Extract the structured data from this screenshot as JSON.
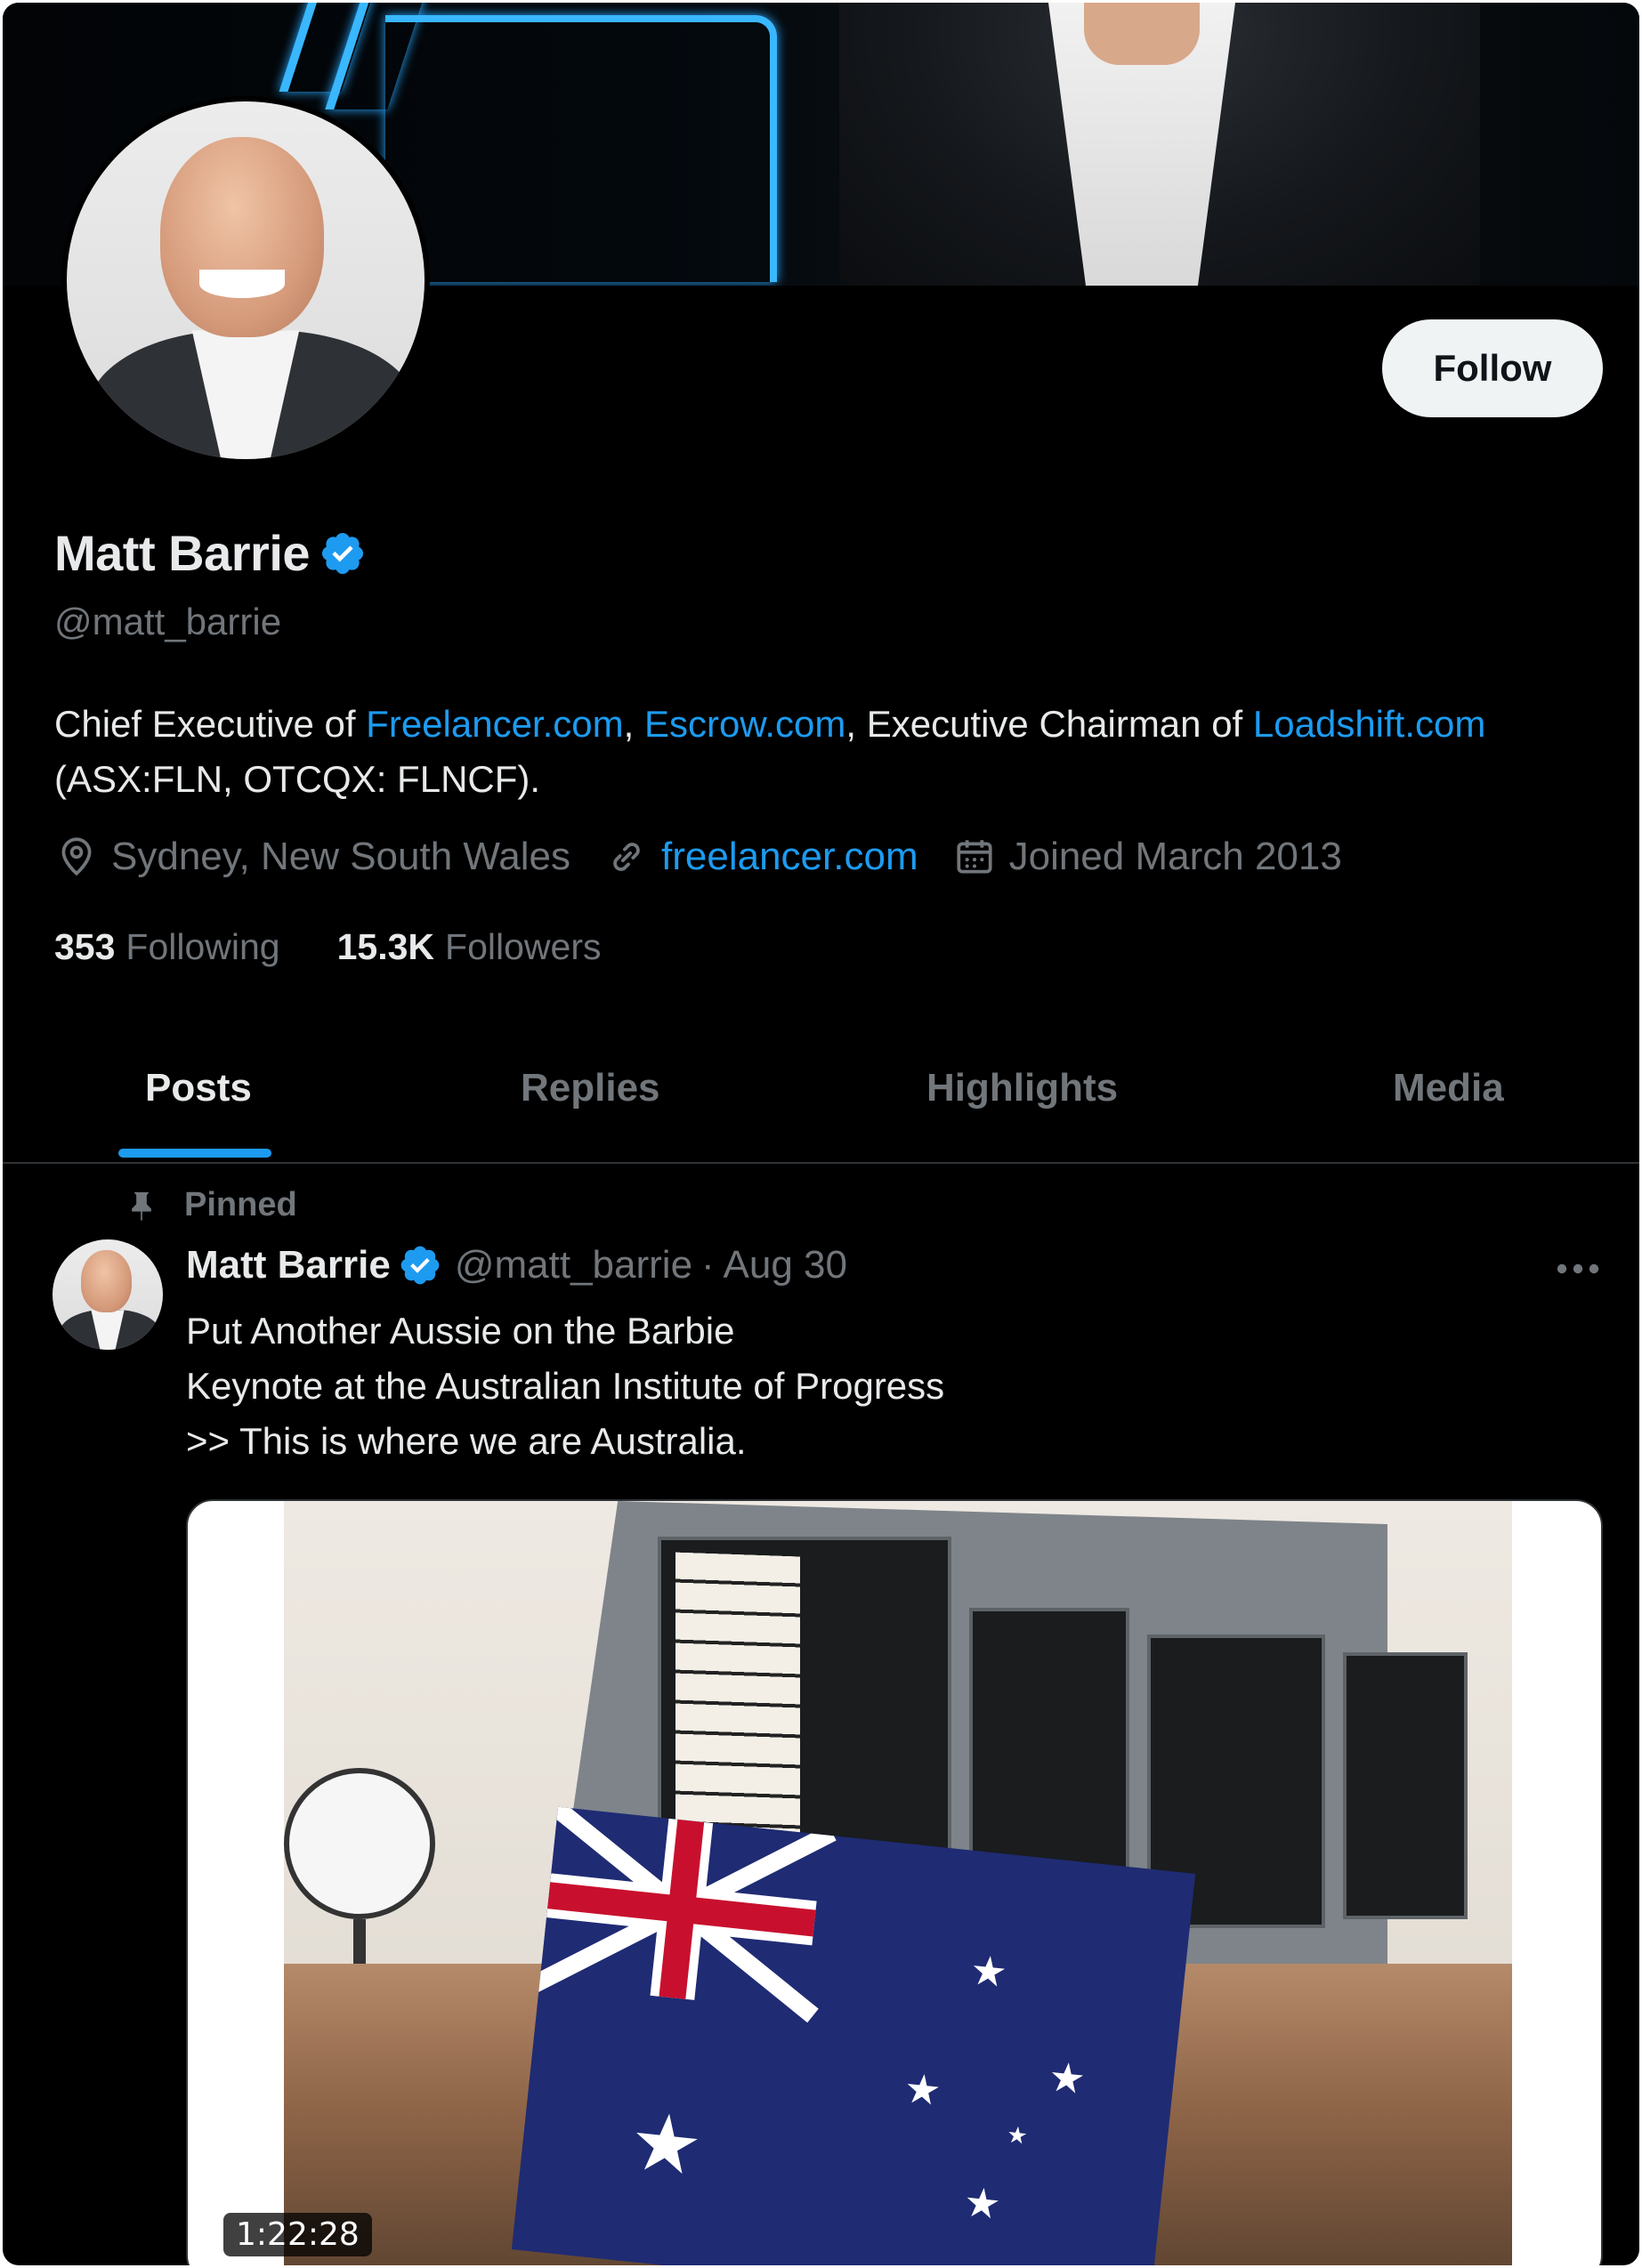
{
  "profile": {
    "display_name": "Matt Barrie",
    "handle": "@matt_barrie",
    "follow_label": "Follow",
    "bio": {
      "prefix": "Chief Executive of ",
      "link1": "Freelancer.com",
      "sep1": ", ",
      "link2": "Escrow.com",
      "middle": ", Executive Chairman of ",
      "link3": "Loadshift.com",
      "line2": "(ASX:FLN, OTCQX: FLNCF)."
    },
    "location": "Sydney, New South Wales",
    "website": "freelancer.com",
    "joined": "Joined March 2013",
    "following_count": "353",
    "following_label": "Following",
    "followers_count": "15.3K",
    "followers_label": "Followers"
  },
  "tabs": [
    "Posts",
    "Replies",
    "Highlights",
    "Media"
  ],
  "active_tab": "Posts",
  "post": {
    "pinned_label": "Pinned",
    "author_name": "Matt Barrie",
    "author_handle": "@matt_barrie",
    "date": "· Aug 30",
    "lines": [
      "Put Another Aussie on the Barbie",
      "Keynote at the Australian Institute of Progress",
      ">> This is where we are Australia."
    ],
    "video_duration": "1:22:28"
  },
  "colors": {
    "background": "#000000",
    "accent": "#1d9bf0",
    "text_primary": "#e7e9ea",
    "text_secondary": "#71767b"
  }
}
